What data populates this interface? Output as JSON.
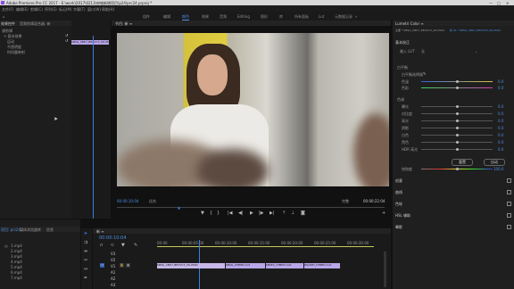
{
  "titlebar": {
    "title": "Adobe Premiere Pro CC 2017 - E:\\work\\2017\\0213\\申城新增项目\\p24\\prc24.prproj *"
  },
  "menu": [
    "文件(F)",
    "编辑(E)",
    "剪辑(C)",
    "序列(S)",
    "标记(M)",
    "字幕(T)",
    "窗口(W)",
    "帮助(H)"
  ],
  "workspaces": [
    "组件",
    "编辑",
    "颜色",
    "效果",
    "音频",
    "Editing",
    "图形",
    "库",
    "所有面板",
    "Lut",
    "元数据记录"
  ],
  "active_workspace": "颜色",
  "left_panel": {
    "tabs": [
      "效果控件",
      "音频剪辑混合器: 新",
      "元数据"
    ],
    "items": [
      "源剪辑",
      "> 基本效果",
      "运动",
      "不透明度",
      "时间重映射"
    ],
    "clip_label": "KBSG_CBK7_BEOVC3_06-0590"
  },
  "program": {
    "tab": "节目: 新 ≡",
    "timecode_left": "00:00:10:04",
    "fit": "适合",
    "quality": "完整",
    "timecode_right": "00:00:22:04"
  },
  "lumetri": {
    "title": "Lumetri Color ≡",
    "header": "主要 * KBSG_CBK7_BEOVC3_06-0590",
    "seq_label": "新 01 * KBSG_CBK7_BEOVC3_06-0590",
    "sections": [
      "基本校正",
      "输入 LUT",
      "白平衡",
      "白平衡选择器",
      "色调",
      "创意",
      "曲线",
      "色轮",
      "HSL 辅助",
      "晕影"
    ],
    "lut_value": "无",
    "wb_sliders": [
      {
        "label": "色温",
        "value": "0.0"
      },
      {
        "label": "色彩",
        "value": "0.0"
      }
    ],
    "tone_sliders": [
      {
        "label": "曝光",
        "value": "0.0"
      },
      {
        "label": "对比度",
        "value": "0.0"
      },
      {
        "label": "高光",
        "value": "0.0"
      },
      {
        "label": "阴影",
        "value": "0.0"
      },
      {
        "label": "白色",
        "value": "0.0"
      },
      {
        "label": "黑色",
        "value": "0.0"
      },
      {
        "label": "HDR 高光",
        "value": "0.0"
      }
    ],
    "saturation": {
      "label": "饱和度",
      "value": "100.0"
    },
    "buttons": [
      "重置",
      "自动"
    ],
    "extra_sections": [
      "创意",
      "曲线",
      "色轮",
      "HSL 辅助",
      "晕影"
    ]
  },
  "project": {
    "tabs": [
      "项目: prc24",
      "媒体浏览器",
      "库",
      "信息"
    ],
    "items": [
      "1.mp4",
      "2.mp4",
      "3.mp4",
      "4.mp4",
      "5.mp4",
      "6.mp4",
      "7.mp4"
    ]
  },
  "timeline": {
    "tab": "新 ≡",
    "timecode": "00:00:10:04",
    "ruler": [
      "00:00",
      "00:00:05:00",
      "00:00:10:00",
      "00:00:15:00",
      "00:00:20:00",
      "00:00:25:00",
      "00:00:30:00"
    ],
    "tracks": [
      "V3",
      "V2",
      "V1",
      "A1",
      "A2",
      "A3"
    ],
    "clips": [
      "KBSG_CBK7_BEOVC3_06-0590",
      "KBSG_CTBHD.mxf",
      "KBSFC_CTBHD.mxf",
      "WG3ZH_CTBHD.mxf"
    ]
  }
}
